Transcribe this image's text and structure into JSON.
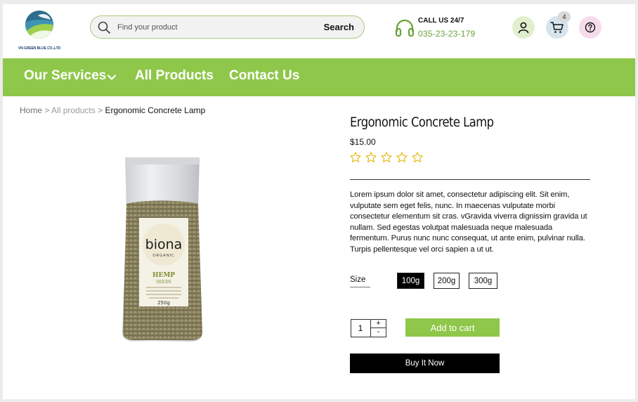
{
  "brand": {
    "logo_text": "VN GREEN BLUE CO.,LTD"
  },
  "search": {
    "placeholder": "Find your product",
    "value": "",
    "button_label": "Search"
  },
  "contact": {
    "call_title": "CALL US 24/7",
    "phone": "035-23-23-179"
  },
  "header_icons": [
    {
      "name": "user-icon"
    },
    {
      "name": "cart-icon",
      "badge": "4"
    },
    {
      "name": "help-icon"
    }
  ],
  "nav": {
    "items": [
      {
        "label": "Our Services",
        "has_dropdown": true
      },
      {
        "label": "All Products"
      },
      {
        "label": "Contact Us"
      }
    ]
  },
  "breadcrumb": {
    "home": "Home",
    "separator": ">",
    "category": "All products",
    "current": "Ergonomic Concrete Lamp"
  },
  "product": {
    "title": "Ergonomic Concrete Lamp",
    "price": "$15.00",
    "rating": {
      "filled": 0,
      "max": 5
    },
    "description": "Lorem ipsum dolor sit amet, consectetur adipiscing elit. Sit enim, vulputate sem eget felis, nunc. In maecenas vulputate morbi consectetur elementum sit cras. vGravida viverra dignissim gravida ut nullam. Sed egestas volutpat malesuada neque malesuada fermentum. Purus nunc nunc consequat, ut ante enim, pulvinar nulla. Turpis pellentesque vel orci sapien a ut ut.",
    "size_label": "Size",
    "sizes": [
      "100g",
      "200g",
      "300g"
    ],
    "selected_size": "100g",
    "quantity": "1",
    "qty_plus": "+",
    "qty_minus": "-",
    "add_to_cart_label": "Add to cart",
    "buy_now_label": "Buy It Now",
    "image": {
      "brand": "biona",
      "sub_brand": "ORGANIC",
      "product_name": "HEMP",
      "product_sub": "SEEDS",
      "weight": "250g"
    }
  },
  "colors": {
    "accent_green": "#8fc74a",
    "phone_green": "#6aa13b",
    "star_gold": "#e2b300",
    "black": "#000000"
  }
}
